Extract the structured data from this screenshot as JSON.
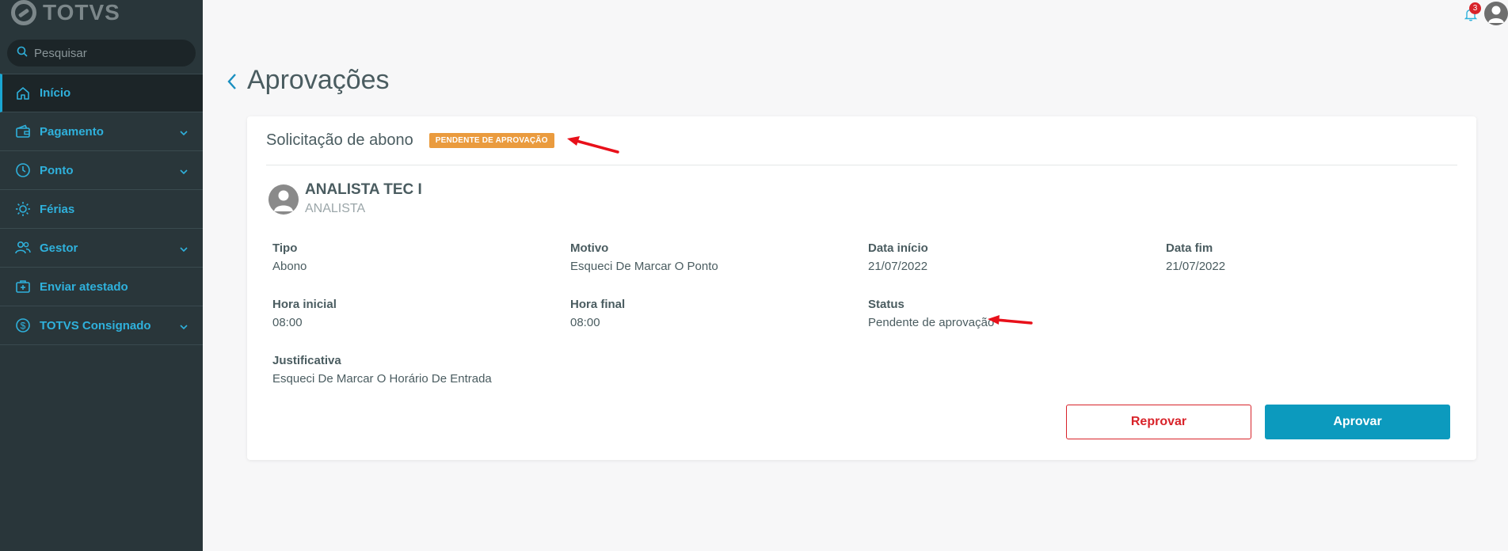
{
  "brand": {
    "name": "TOTVS"
  },
  "search": {
    "placeholder": "Pesquisar"
  },
  "sidebar": {
    "items": [
      {
        "label": "Início",
        "icon": "home-icon",
        "active": true
      },
      {
        "label": "Pagamento",
        "icon": "wallet-icon",
        "expandable": true
      },
      {
        "label": "Ponto",
        "icon": "clock-icon",
        "expandable": true
      },
      {
        "label": "Férias",
        "icon": "sun-icon"
      },
      {
        "label": "Gestor",
        "icon": "users-icon",
        "expandable": true
      },
      {
        "label": "Enviar atestado",
        "icon": "medical-kit-icon"
      },
      {
        "label": "TOTVS Consignado",
        "icon": "dollar-circle-icon",
        "expandable": true
      }
    ]
  },
  "topbar": {
    "notification_count": "3"
  },
  "page": {
    "title": "Aprovações"
  },
  "card": {
    "title": "Solicitação de abono",
    "status_tag": "PENDENTE DE APROVAÇÃO",
    "employee": {
      "name": "ANALISTA TEC I",
      "role": "ANALISTA"
    },
    "fields": {
      "tipo": {
        "label": "Tipo",
        "value": "Abono"
      },
      "motivo": {
        "label": "Motivo",
        "value": "Esqueci De Marcar O Ponto"
      },
      "data_inicio": {
        "label": "Data início",
        "value": "21/07/2022"
      },
      "data_fim": {
        "label": "Data fim",
        "value": "21/07/2022"
      },
      "hora_inicial": {
        "label": "Hora inicial",
        "value": "08:00"
      },
      "hora_final": {
        "label": "Hora final",
        "value": "08:00"
      },
      "status": {
        "label": "Status",
        "value": "Pendente de aprovação"
      },
      "justificativa": {
        "label": "Justificativa",
        "value": "Esqueci De Marcar O Horário De Entrada"
      }
    },
    "actions": {
      "reject_label": "Reprovar",
      "approve_label": "Aprovar"
    }
  },
  "colors": {
    "sidebar_bg": "#29363a",
    "accent": "#2fb1dc",
    "tag_bg": "#ea9b3e",
    "approve_bg": "#0c9abe",
    "reject": "#d8232a",
    "annotation_arrow": "#e8101a"
  }
}
